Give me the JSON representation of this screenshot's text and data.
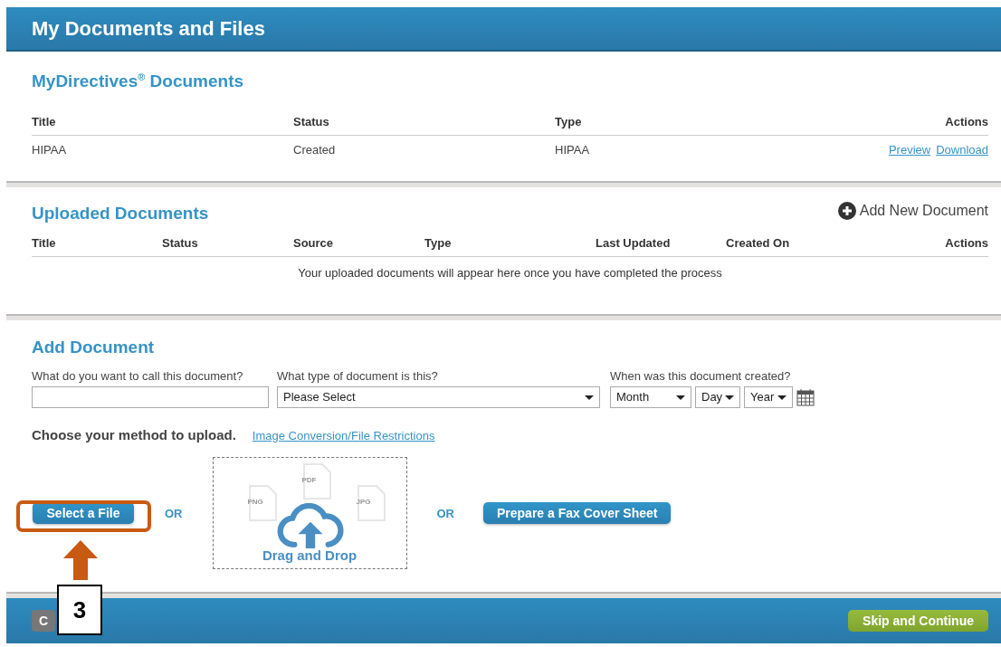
{
  "header": {
    "title": "My Documents and Files"
  },
  "mydirectives": {
    "title": "MyDirectives$^{®}$ Documents",
    "columns": [
      "Title",
      "Status",
      "Type",
      "Actions"
    ],
    "rows": [
      {
        "cells": [
          "HIPAA",
          "Created",
          "HIPAA"
        ],
        "actions": [
          "Preview",
          "Download"
        ]
      }
    ]
  },
  "uploaded": {
    "title": "Uploaded Documents",
    "add_button": "Add New Document",
    "columns": [
      "Title",
      "Status",
      "Source",
      "Type",
      "Last Updated",
      "Created On",
      "Actions"
    ],
    "empty_message": "Your uploaded documents will appear here once you have completed the process"
  },
  "add_document": {
    "title": "Add Document",
    "fields": [
      {
        "kind": "text",
        "label": "What do you want to call this document?"
      },
      {
        "kind": "select",
        "label": "What type of document is this?",
        "value": "Please Select"
      },
      {
        "kind": "date",
        "label": "When was this document created?",
        "parts": [
          "Month",
          "Day",
          "Year"
        ]
      }
    ]
  },
  "upload": {
    "prompt": "Choose your method to upload.",
    "restrictions_link": "Image Conversion/File Restrictions",
    "select_button": "Select a File",
    "separators": [
      "OR",
      "OR"
    ],
    "dropzone": {
      "file_types": [
        "PNG",
        "PDF",
        "JPG"
      ],
      "label": "Drag and Drop"
    },
    "fax_button": "Prepare a Fax Cover Sheet"
  },
  "footer": {
    "cancel_button": "C",
    "continue_button": "Skip and Continue"
  },
  "annotation": {
    "step": "3"
  }
}
